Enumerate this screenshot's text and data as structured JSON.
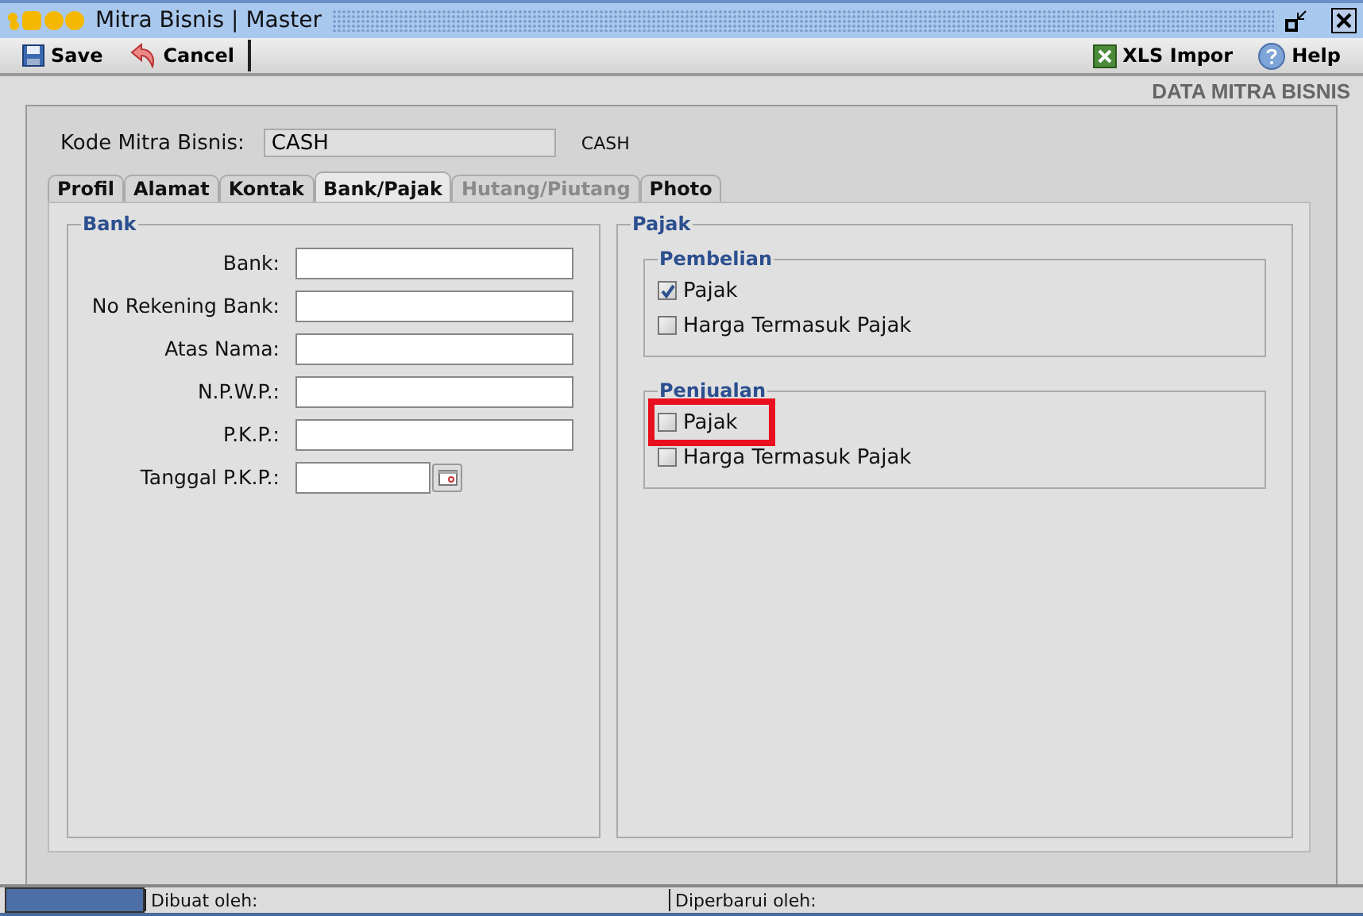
{
  "window": {
    "title": "Mitra Bisnis | Master"
  },
  "toolbar": {
    "left": [
      {
        "label": "Save",
        "kind": "save"
      },
      {
        "label": "Cancel",
        "kind": "cancel"
      }
    ],
    "right": [
      {
        "label": "XLS Impor",
        "kind": "excel"
      },
      {
        "label": "Help",
        "kind": "help"
      }
    ]
  },
  "header": "DATA MITRA BISNIS",
  "kode": {
    "label": "Kode Mitra Bisnis:",
    "value": "CASH",
    "caption": "CASH"
  },
  "tabs": [
    {
      "label": "Profil",
      "selected": false,
      "disabled": false
    },
    {
      "label": "Alamat",
      "selected": false,
      "disabled": false
    },
    {
      "label": "Kontak",
      "selected": false,
      "disabled": false
    },
    {
      "label": "Bank/Pajak",
      "selected": true,
      "disabled": false
    },
    {
      "label": "Hutang/Piutang",
      "selected": false,
      "disabled": true
    },
    {
      "label": "Photo",
      "selected": false,
      "disabled": false
    }
  ],
  "bank": {
    "title": "Bank",
    "fields": [
      {
        "label": "Bank:",
        "kind": "text"
      },
      {
        "label": "No Rekening Bank:",
        "kind": "text"
      },
      {
        "label": "Atas Nama:",
        "kind": "text"
      },
      {
        "label": "N.P.W.P.:",
        "kind": "text"
      },
      {
        "label": "P.K.P.:",
        "kind": "text"
      },
      {
        "label": "Tanggal P.K.P.:",
        "kind": "date"
      }
    ]
  },
  "pajak": {
    "title": "Pajak",
    "groups": [
      {
        "title": "Pembelian",
        "options": [
          {
            "label": "Pajak",
            "checked": true,
            "highlighted": false
          },
          {
            "label": "Harga Termasuk Pajak",
            "checked": false,
            "highlighted": false
          }
        ]
      },
      {
        "title": "Penjualan",
        "options": [
          {
            "label": "Pajak",
            "checked": false,
            "highlighted": true
          },
          {
            "label": "Harga Termasuk Pajak",
            "checked": false,
            "highlighted": false
          }
        ]
      }
    ]
  },
  "status_bar": {
    "progress": {
      "level": 1
    },
    "created_by": "Dibuat oleh:",
    "updated_by": "Diperbarui oleh:"
  }
}
